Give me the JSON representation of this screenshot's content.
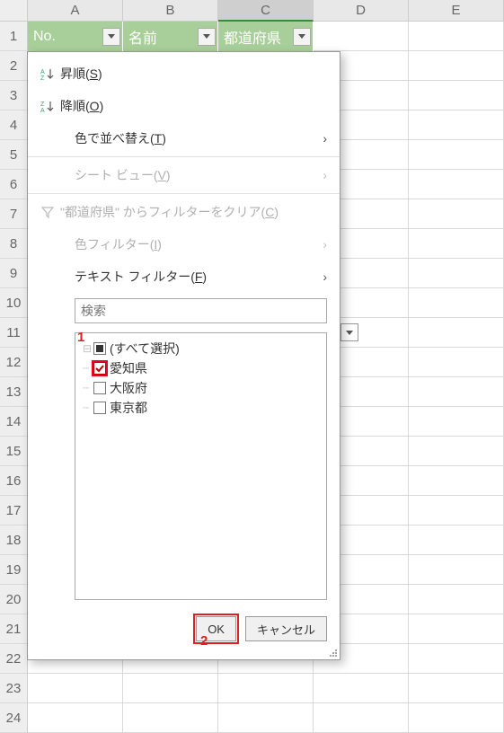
{
  "columns": [
    "A",
    "B",
    "C",
    "D",
    "E"
  ],
  "row_numbers": [
    1,
    2,
    3,
    4,
    5,
    6,
    7,
    8,
    9,
    10,
    11,
    12,
    13,
    14,
    15,
    16,
    17,
    18,
    19,
    20,
    21,
    22,
    23,
    24
  ],
  "headers": {
    "no": "No.",
    "name": "名前",
    "pref": "都道府県"
  },
  "filter_menu": {
    "sort_asc": "昇順(S)",
    "sort_desc": "降順(O)",
    "sort_color": "色で並べ替え(T)",
    "sheet_view": "シート ビュー(V)",
    "clear_filter": "\"都道府県\" からフィルターをクリア(C)",
    "color_filter": "色フィルター(I)",
    "text_filter": "テキスト フィルター(F)",
    "search_placeholder": "検索",
    "items": {
      "select_all": "(すべて選択)",
      "aichi": "愛知県",
      "osaka": "大阪府",
      "tokyo": "東京都"
    },
    "ok": "OK",
    "cancel": "キャンセル"
  },
  "annotations": {
    "one": "1",
    "two": "2"
  }
}
